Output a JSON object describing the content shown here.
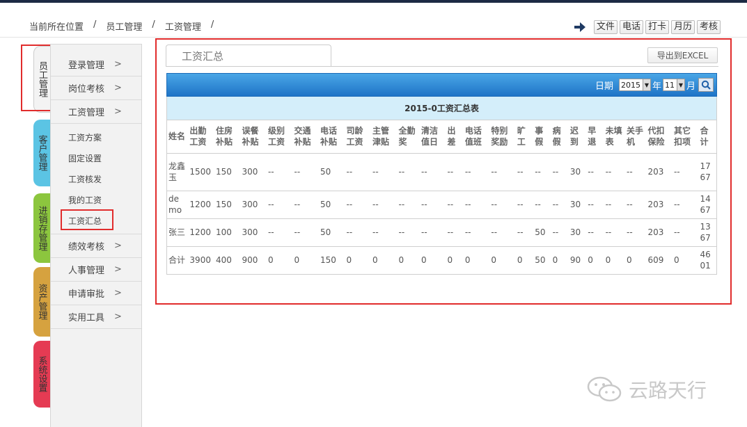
{
  "breadcrumb": [
    "当前所在位置",
    "员工管理",
    "工资管理"
  ],
  "breadcrumb_sep": "/",
  "toolbar": [
    "文件",
    "电话",
    "打卡",
    "月历",
    "考核"
  ],
  "vertical_tabs": [
    "员工管理",
    "客户管理",
    "进销存管理",
    "资产管理",
    "系统设置"
  ],
  "menu": {
    "items": [
      {
        "label": "登录管理",
        "chev": ">"
      },
      {
        "label": "岗位考核",
        "chev": ">"
      },
      {
        "label": "工资管理",
        "chev": ">"
      }
    ],
    "sub_items": [
      "工资方案",
      "固定设置",
      "工资核发",
      "我的工资",
      "工资汇总"
    ],
    "items_after": [
      {
        "label": "绩效考核",
        "chev": ">"
      },
      {
        "label": "人事管理",
        "chev": ">"
      },
      {
        "label": "申请审批",
        "chev": ">"
      },
      {
        "label": "实用工具",
        "chev": ">"
      }
    ]
  },
  "panel": {
    "tab_title": "工资汇总",
    "export_label": "导出到EXCEL",
    "date_label": "日期",
    "year": "2015",
    "year_unit": "年",
    "month": "11",
    "month_unit": "月"
  },
  "table": {
    "title": "2015-0工资汇总表",
    "headers": [
      "姓名",
      "出勤工资",
      "住房补贴",
      "误餐补贴",
      "级别工资",
      "交通补贴",
      "电话补贴",
      "司龄工资",
      "主管津贴",
      "全勤奖",
      "清洁值日",
      "出差",
      "电话值班",
      "特别奖励",
      "旷工",
      "事假",
      "病假",
      "迟到",
      "早退",
      "未填表",
      "关手机",
      "代扣保险",
      "其它扣项",
      "合计"
    ],
    "rows": [
      [
        "龙鑫玉",
        "1500",
        "150",
        "300",
        "--",
        "--",
        "50",
        "--",
        "--",
        "--",
        "--",
        "--",
        "--",
        "--",
        "--",
        "--",
        "--",
        "30",
        "--",
        "--",
        "--",
        "203",
        "--",
        "1767"
      ],
      [
        "demo",
        "1200",
        "150",
        "300",
        "--",
        "--",
        "50",
        "--",
        "--",
        "--",
        "--",
        "--",
        "--",
        "--",
        "--",
        "--",
        "--",
        "30",
        "--",
        "--",
        "--",
        "203",
        "--",
        "1467"
      ],
      [
        "张三",
        "1200",
        "100",
        "300",
        "--",
        "--",
        "50",
        "--",
        "--",
        "--",
        "--",
        "--",
        "--",
        "--",
        "--",
        "50",
        "--",
        "30",
        "--",
        "--",
        "--",
        "203",
        "--",
        "1367"
      ],
      [
        "合计",
        "3900",
        "400",
        "900",
        "0",
        "0",
        "150",
        "0",
        "0",
        "0",
        "0",
        "0",
        "0",
        "0",
        "0",
        "50",
        "0",
        "90",
        "0",
        "0",
        "0",
        "609",
        "0",
        "4601"
      ]
    ]
  },
  "watermark": "云路天行",
  "colors": {
    "accent_red": "#e12c2c",
    "bar_blue": "#1e74c7",
    "tab_blue": "#5bc4e4",
    "tab_green": "#8cc63e",
    "tab_orange": "#d6a23f",
    "tab_red": "#e53b53"
  }
}
